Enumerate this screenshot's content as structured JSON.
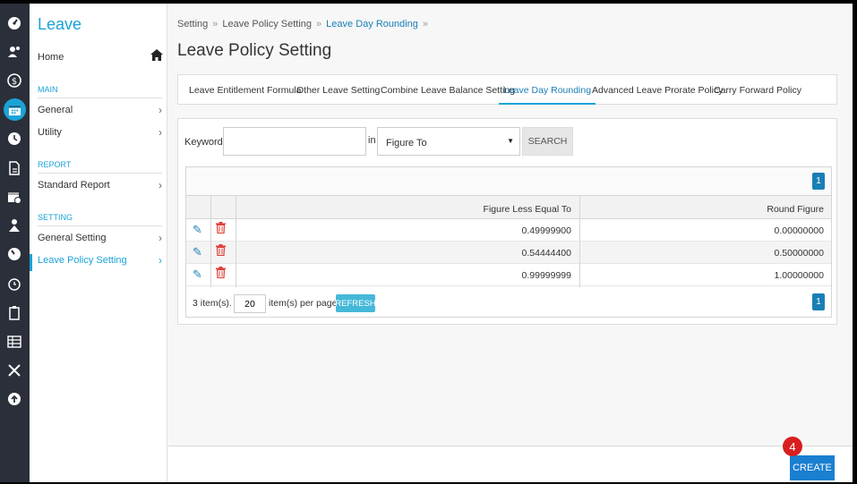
{
  "sidebar": {
    "title": "Leave",
    "home_label": "Home",
    "sections": {
      "main": "MAIN",
      "report": "REPORT",
      "setting": "SETTING"
    },
    "items": {
      "general": "General",
      "utility": "Utility",
      "standard_report": "Standard Report",
      "general_setting": "General Setting",
      "leave_policy_setting": "Leave Policy Setting"
    },
    "active_item": "Leave Policy Setting"
  },
  "rail_icons": [
    "dashboard-icon",
    "users-icon",
    "dollar-icon",
    "calendar-icon",
    "clock-icon",
    "document-icon",
    "calendar-check-icon",
    "people-icon",
    "speedometer-icon",
    "timer-icon",
    "clipboard-icon",
    "table-icon",
    "tools-icon",
    "upload-icon"
  ],
  "breadcrumb": {
    "items": [
      "Setting",
      "Leave Policy Setting",
      "Leave Day Rounding"
    ],
    "separator": "»"
  },
  "page_title": "Leave Policy Setting",
  "tabs": [
    {
      "label": "Leave Entitlement Formula",
      "active": false
    },
    {
      "label": "Other Leave Setting",
      "active": false
    },
    {
      "label": "Combine Leave Balance Setting",
      "active": false
    },
    {
      "label": "Leave Day Rounding",
      "active": true
    },
    {
      "label": "Advanced Leave Prorate Policy",
      "active": false
    },
    {
      "label": "Carry Forward Policy",
      "active": false
    }
  ],
  "search": {
    "keyword_label": "Keyword:",
    "keyword_value": "",
    "in_label": "in",
    "field_selected": "Figure To",
    "button_label": "SEARCH"
  },
  "grid": {
    "page_number": "1",
    "columns": [
      "Figure Less Equal To",
      "Round Figure"
    ],
    "rows": [
      [
        "0.49999900",
        "0.00000000"
      ],
      [
        "0.54444400",
        "0.50000000"
      ],
      [
        "0.99999999",
        "1.00000000"
      ]
    ],
    "items_count": "3 item(s).",
    "per_page_value": "20",
    "per_page_label": "item(s) per page.",
    "refresh_label": "REFRESH",
    "footer_page_number": "1"
  },
  "footer": {
    "create_label": "CREATE",
    "step_badge": "4"
  },
  "colors": {
    "accent": "#1aa3d8",
    "link": "#1a7fb5",
    "rail": "#2b2f3a",
    "delete": "#e0403a",
    "create": "#1a7fd0",
    "badge": "#d81f1f"
  }
}
